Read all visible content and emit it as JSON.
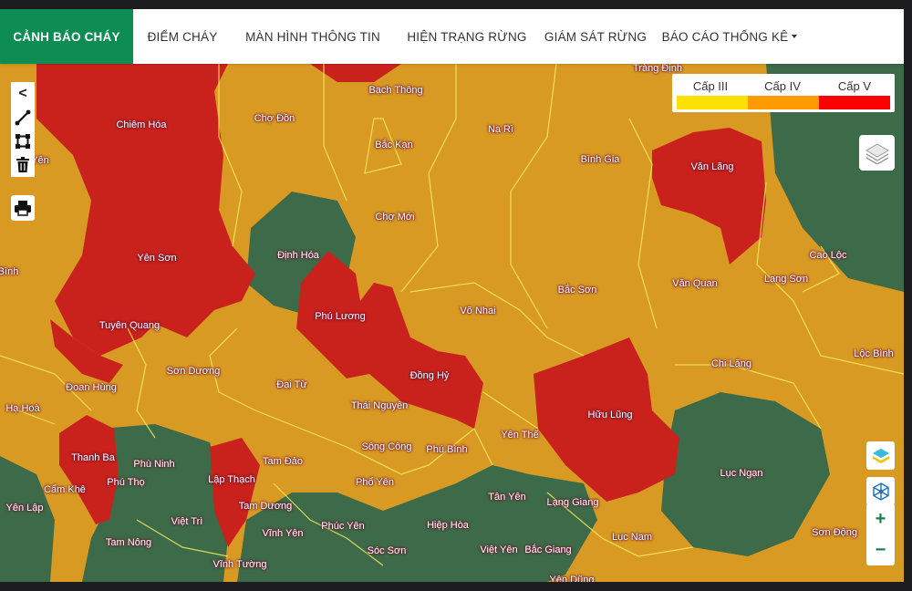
{
  "nav": {
    "items": [
      {
        "label": "CẢNH BÁO CHÁY"
      },
      {
        "label": "ĐIỂM CHÁY"
      },
      {
        "label": "MÀN HÌNH THÔNG TIN"
      },
      {
        "label": "HIỆN TRẠNG RỪNG"
      },
      {
        "label": "GIÁM SÁT RỪNG"
      },
      {
        "label": "BÁO CÁO THỐNG KÊ"
      }
    ]
  },
  "legend": {
    "levels": [
      {
        "label": "Cấp III",
        "color": "#ffe100"
      },
      {
        "label": "Cấp IV",
        "color": "#ff9a00"
      },
      {
        "label": "Cấp V",
        "color": "#ff0000"
      }
    ]
  },
  "colors": {
    "level_iii": "#e9c21c",
    "level_iv": "#d99a24",
    "level_v": "#c9221c",
    "forest": "#3d6a48",
    "active_nav": "#0d8c53"
  },
  "toolbar": {
    "collapse": "<",
    "icons": [
      "polyline-icon",
      "polygon-icon",
      "trash-icon",
      "print-icon"
    ]
  },
  "zoom": {
    "in": "+",
    "out": "−"
  },
  "districts": [
    {
      "name": "Tràng Định",
      "level": "IV"
    },
    {
      "name": "Bạch Thông",
      "level": "IV"
    },
    {
      "name": "Chiêm Hóa",
      "level": "V"
    },
    {
      "name": "Chợ Đồn",
      "level": "IV"
    },
    {
      "name": "Na Rì",
      "level": "IV"
    },
    {
      "name": "Bắc Kạn",
      "level": "IV"
    },
    {
      "name": "Bình Gia",
      "level": "IV"
    },
    {
      "name": "Văn Lãng",
      "level": "V"
    },
    {
      "name": "Yên",
      "level": "IV"
    },
    {
      "name": "Chợ Mới",
      "level": "IV"
    },
    {
      "name": "Định Hóa",
      "level": "forest"
    },
    {
      "name": "Yên Sơn",
      "level": "V"
    },
    {
      "name": "Cao Lộc",
      "level": "IV"
    },
    {
      "name": "Lạng Sơn",
      "level": "IV"
    },
    {
      "name": "Bình",
      "level": "IV"
    },
    {
      "name": "Bắc Sơn",
      "level": "IV"
    },
    {
      "name": "Văn Quan",
      "level": "IV"
    },
    {
      "name": "Võ Nhai",
      "level": "IV"
    },
    {
      "name": "Phú Lương",
      "level": "V"
    },
    {
      "name": "Tuyên Quang",
      "level": "IV"
    },
    {
      "name": "Lộc Bình",
      "level": "IV"
    },
    {
      "name": "Chi Lăng",
      "level": "IV"
    },
    {
      "name": "Sơn Dương",
      "level": "IV"
    },
    {
      "name": "Đồng Hỷ",
      "level": "V"
    },
    {
      "name": "Đoan Hùng",
      "level": "IV"
    },
    {
      "name": "Đại Từ",
      "level": "IV"
    },
    {
      "name": "Thái Nguyên",
      "level": "IV"
    },
    {
      "name": "Hạ Hoà",
      "level": "IV"
    },
    {
      "name": "Hữu Lũng",
      "level": "V"
    },
    {
      "name": "Yên Thế",
      "level": "IV"
    },
    {
      "name": "Sông Công",
      "level": "IV"
    },
    {
      "name": "Phú Bình",
      "level": "IV"
    },
    {
      "name": "Thanh Ba",
      "level": "V"
    },
    {
      "name": "Phù Ninh",
      "level": "forest"
    },
    {
      "name": "Tam Đảo",
      "level": "IV"
    },
    {
      "name": "Lục Ngạn",
      "level": "forest"
    },
    {
      "name": "Lập Thạch",
      "level": "V"
    },
    {
      "name": "Phú Thọ",
      "level": "V"
    },
    {
      "name": "Phổ Yên",
      "level": "IV"
    },
    {
      "name": "Cẩm Khê",
      "level": "IV"
    },
    {
      "name": "Tân Yên",
      "level": "forest"
    },
    {
      "name": "Lạng Giang",
      "level": "forest"
    },
    {
      "name": "Tam Dương",
      "level": "IV"
    },
    {
      "name": "Yên Lập",
      "level": "forest"
    },
    {
      "name": "Việt Trì",
      "level": "forest"
    },
    {
      "name": "Phúc Yên",
      "level": "forest"
    },
    {
      "name": "Hiệp Hòa",
      "level": "forest"
    },
    {
      "name": "Vĩnh Yên",
      "level": "forest"
    },
    {
      "name": "Sơn Động",
      "level": "IV"
    },
    {
      "name": "Lục Nam",
      "level": "IV"
    },
    {
      "name": "Tam Nông",
      "level": "IV"
    },
    {
      "name": "Việt Yên",
      "level": "IV"
    },
    {
      "name": "Bắc Giang",
      "level": "IV"
    },
    {
      "name": "Sóc Sơn",
      "level": "forest"
    },
    {
      "name": "Vĩnh Tường",
      "level": "forest"
    },
    {
      "name": "Yên Dũng",
      "level": "forest"
    }
  ]
}
